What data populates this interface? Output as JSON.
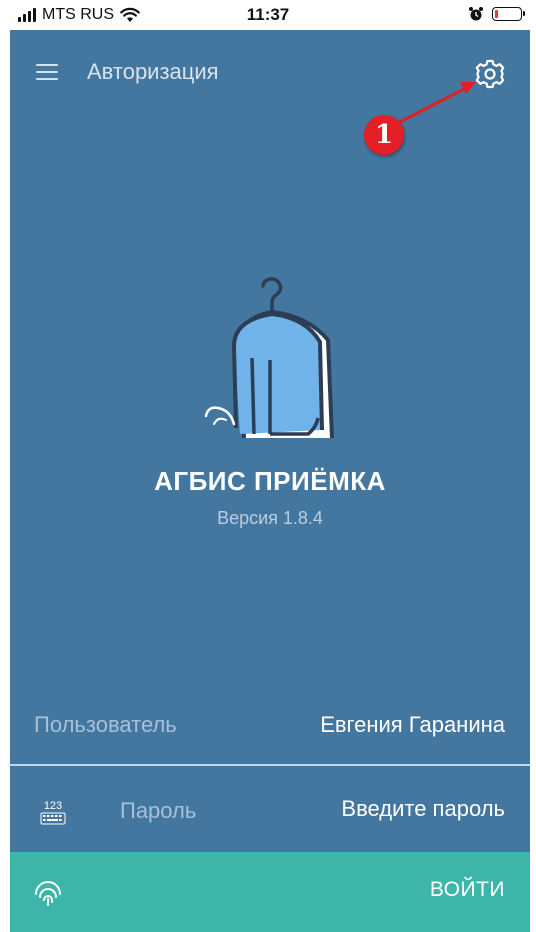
{
  "status_bar": {
    "carrier": "MTS RUS",
    "time": "11:37",
    "battery_level": 0.12,
    "battery_color": "#e53935"
  },
  "appbar": {
    "title": "Авторизация",
    "menu_icon": "hamburger-menu-icon",
    "settings_icon": "gear-icon"
  },
  "annotation": {
    "badge_label": "1",
    "color": "#e31e24"
  },
  "logo": {
    "icon": "coat-hanger-garment-logo",
    "app_name": "АГБИС ПРИЁМКА",
    "version": "Версия 1.8.4"
  },
  "form": {
    "user_label": "Пользователь",
    "user_value": "Евгения Гаранина",
    "password_label": "Пароль",
    "password_placeholder": "Введите пароль",
    "keyboard_icon": "numeric-keyboard-icon"
  },
  "footer": {
    "fingerprint_icon": "fingerprint-icon",
    "login_label": "ВОЙТИ"
  },
  "colors": {
    "screen_bg": "#44779f",
    "footer_bg": "#3eb5a9",
    "garment": "#6fb3e8",
    "outline": "#2b3e56"
  }
}
